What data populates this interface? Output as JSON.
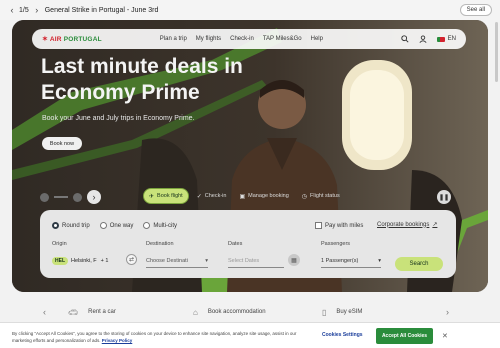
{
  "alert": {
    "prev_icon": "chevron-left-icon",
    "next_icon": "chevron-right-icon",
    "prev": "‹",
    "pager": "1/5",
    "next": "›",
    "message": "General Strike in Portugal - June 3rd",
    "see_all": "See all"
  },
  "nav": {
    "logo_mark": "✶",
    "logo_text_a": "AIR",
    "logo_text_b": "PORTUGAL",
    "links": [
      "Plan a trip",
      "My flights",
      "Check-in",
      "TAP Miles&Go",
      "Help"
    ],
    "language": "EN"
  },
  "hero": {
    "headline": "Last minute deals in Economy Prime",
    "subhead": "Book your June and July trips in Economy Prime.",
    "cta": "Book now"
  },
  "booking_tabs": [
    {
      "label": "Book flight",
      "icon": "plane-icon",
      "glyph": "✈"
    },
    {
      "label": "Check-in",
      "icon": "check-circle-icon",
      "glyph": "✓"
    },
    {
      "label": "Manage booking",
      "icon": "suitcase-icon",
      "glyph": "▣"
    },
    {
      "label": "Flight status",
      "icon": "clock-icon",
      "glyph": "◷"
    }
  ],
  "search": {
    "trip_types": [
      "Round trip",
      "One way",
      "Multi-city"
    ],
    "selected_trip": "Round trip",
    "pay_with_miles": "Pay with miles",
    "corporate": "Corporate bookings",
    "origin_label": "Origin",
    "origin_code": "HEL",
    "origin_value": "Helsinki, F",
    "origin_extra": "+ 1",
    "destination_label": "Destination",
    "destination_placeholder": "Choose Destinati",
    "dates_label": "Dates",
    "dates_placeholder": "Select Dates",
    "passengers_label": "Passengers",
    "passengers_value": "1 Passenger(s)",
    "search_button": "Search"
  },
  "services": [
    "Rent a car",
    "Book accommodation",
    "Buy eSIM"
  ],
  "cookie": {
    "text": "By clicking “Accept All Cookies”, you agree to the storing of cookies on your device to enhance site navigation, analyze site usage, assist in our marketing efforts and personalization of ads.",
    "policy_link": "Privacy Policy",
    "settings": "Cookies Settings",
    "accept": "Accept All Cookies",
    "close": "✕"
  },
  "colors": {
    "brand_green": "#2a8c3b",
    "brand_red": "#d2222d",
    "accent_lime": "#c9e27a"
  }
}
